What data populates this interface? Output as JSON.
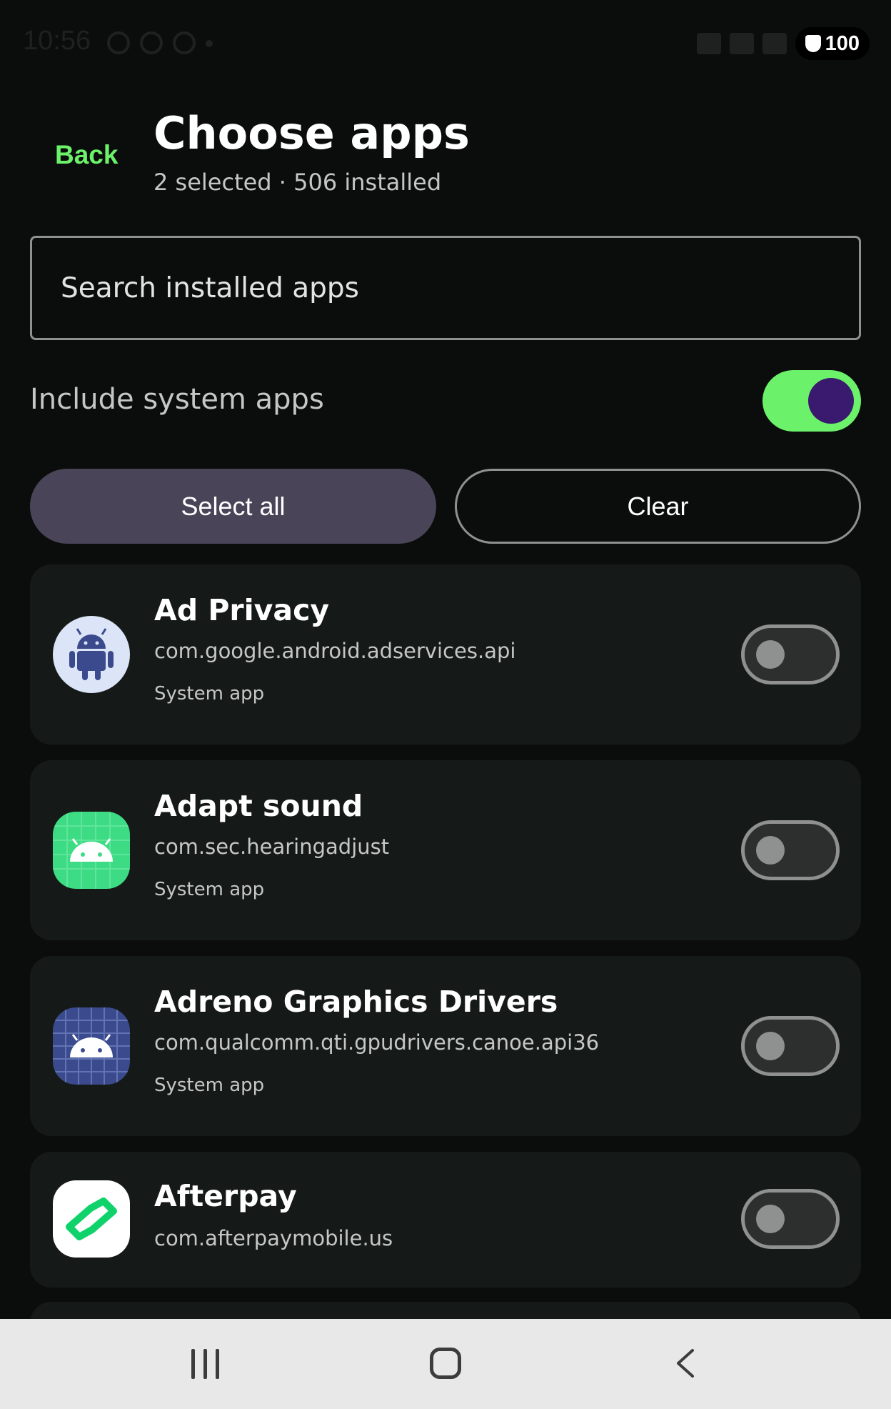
{
  "status_bar": {
    "time": "10:56",
    "battery": "100"
  },
  "header": {
    "back_label": "Back",
    "title": "Choose apps",
    "subtitle": "2 selected · 506 installed"
  },
  "search": {
    "placeholder": "Search installed apps",
    "value": ""
  },
  "system_toggle": {
    "label": "Include system apps",
    "enabled": true
  },
  "actions": {
    "select_all_label": "Select all",
    "clear_label": "Clear"
  },
  "apps": [
    {
      "name": "Ad Privacy",
      "package": "com.google.android.adservices.api",
      "tag": "System app",
      "selected": false,
      "icon": "android-robot-icon",
      "icon_bg": "#dce4f8"
    },
    {
      "name": "Adapt sound",
      "package": "com.sec.hearingadjust",
      "tag": "System app",
      "selected": false,
      "icon": "android-head-icon",
      "icon_bg": "#3ddc84"
    },
    {
      "name": "Adreno Graphics Drivers",
      "package": "com.qualcomm.qti.gpudrivers.canoe.api36",
      "tag": "System app",
      "selected": false,
      "icon": "android-head-icon",
      "icon_bg": "#3a4a8c"
    },
    {
      "name": "Afterpay",
      "package": "com.afterpaymobile.us",
      "tag": "",
      "selected": false,
      "icon": "afterpay-icon",
      "icon_bg": "#ffffff"
    }
  ],
  "colors": {
    "accent": "#6cf26a",
    "background": "#0b0d0c",
    "card": "#151a18",
    "tonal_button": "#4a4458"
  }
}
